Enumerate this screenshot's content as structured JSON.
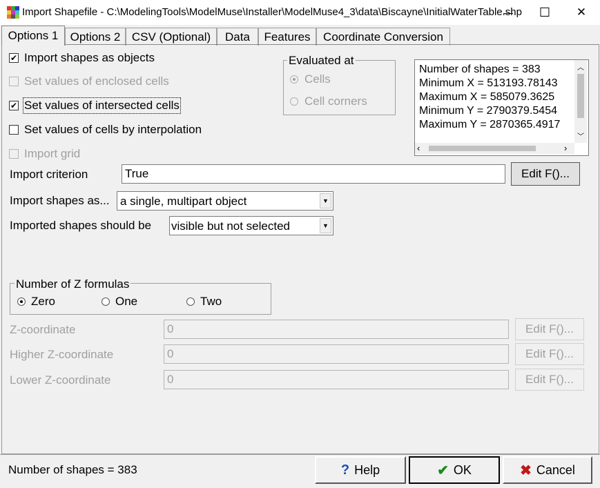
{
  "window": {
    "title": "Import Shapefile - C:\\ModelingTools\\ModelMuse\\Installer\\ModelMuse4_3\\data\\Biscayne\\InitialWaterTable.shp",
    "minimize_glyph": "—",
    "maximize_glyph": "☐",
    "close_glyph": "✕"
  },
  "tabs": [
    {
      "label": "Options 1",
      "active": true
    },
    {
      "label": "Options 2",
      "active": false
    },
    {
      "label": "CSV (Optional)",
      "active": false
    },
    {
      "label": "Data",
      "active": false
    },
    {
      "label": "Features",
      "active": false
    },
    {
      "label": "Coordinate Conversion",
      "active": false
    }
  ],
  "options": {
    "import_objects": {
      "label": "Import shapes as objects",
      "checked": true,
      "enabled": true
    },
    "enclosed_cells": {
      "label": "Set values of enclosed cells",
      "checked": false,
      "enabled": false
    },
    "intersected_cells": {
      "label": "Set values of intersected cells",
      "checked": true,
      "enabled": true
    },
    "interpolation": {
      "label": "Set values of cells by interpolation",
      "checked": false,
      "enabled": true
    },
    "import_grid": {
      "label": "Import grid",
      "checked": false,
      "enabled": false
    }
  },
  "evaluated_at": {
    "title": "Evaluated at",
    "options": [
      {
        "label": "Cells",
        "selected": true
      },
      {
        "label": "Cell corners",
        "selected": false
      }
    ]
  },
  "info_list": {
    "lines": [
      "Number of shapes = 383",
      "Minimum X = 513193.78143",
      "Maximum X = 585079.3625",
      "Minimum Y = 2790379.5454",
      "Maximum Y = 2870365.4917"
    ]
  },
  "import_criterion": {
    "label": "Import criterion",
    "value": "True",
    "button": "Edit F()..."
  },
  "import_shapes_as": {
    "label": "Import shapes as...",
    "value": "a single, multipart object"
  },
  "imported_visibility": {
    "label": "Imported shapes should be",
    "value": "visible but not selected"
  },
  "z_formulas": {
    "title": "Number of Z formulas",
    "options": [
      {
        "label": "Zero",
        "selected": true
      },
      {
        "label": "One",
        "selected": false
      },
      {
        "label": "Two",
        "selected": false
      }
    ]
  },
  "z_fields": [
    {
      "label": "Z-coordinate",
      "value": "0",
      "button": "Edit F()..."
    },
    {
      "label": "Higher Z-coordinate",
      "value": "0",
      "button": "Edit F()..."
    },
    {
      "label": "Lower Z-coordinate",
      "value": "0",
      "button": "Edit F()..."
    }
  ],
  "status": {
    "text": "Number of shapes = 383"
  },
  "footer": {
    "help": {
      "icon": "?",
      "label": "Help"
    },
    "ok": {
      "icon": "✔",
      "label": "OK"
    },
    "cancel": {
      "icon": "✖",
      "label": "Cancel"
    }
  },
  "colors": {
    "ok_icon": "#1a8a1a",
    "cancel_icon": "#c01818",
    "help_icon": "#1a4fb5"
  }
}
